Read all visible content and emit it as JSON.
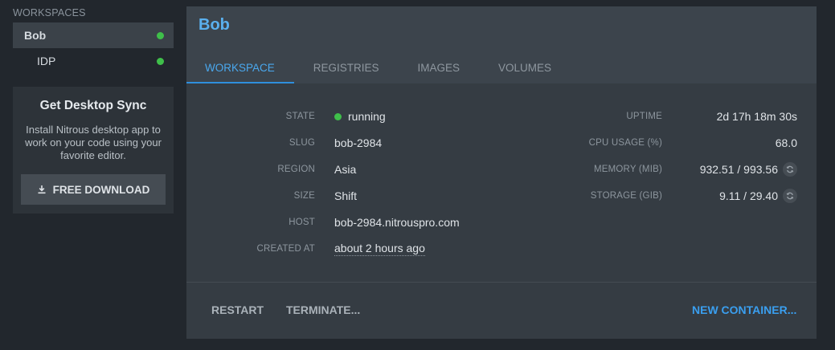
{
  "sidebar": {
    "heading": "WORKSPACES",
    "items": [
      {
        "label": "Bob",
        "status_color": "#3fbf4a",
        "active": true
      },
      {
        "label": "IDP",
        "status_color": "#3fbf4a",
        "active": false
      }
    ],
    "promo": {
      "title": "Get Desktop Sync",
      "text": "Install Nitrous desktop app to work on your code using your favorite editor.",
      "button_label": "FREE DOWNLOAD",
      "button_icon": "download-icon"
    }
  },
  "panel": {
    "title": "Bob",
    "tabs": [
      {
        "label": "WORKSPACE",
        "active": true
      },
      {
        "label": "REGISTRIES",
        "active": false
      },
      {
        "label": "IMAGES",
        "active": false
      },
      {
        "label": "VOLUMES",
        "active": false
      }
    ],
    "details_left": [
      {
        "label": "STATE",
        "value": "running"
      },
      {
        "label": "SLUG",
        "value": "bob-2984"
      },
      {
        "label": "REGION",
        "value": "Asia"
      },
      {
        "label": "SIZE",
        "value": "Shift"
      },
      {
        "label": "HOST",
        "value": "bob-2984.nitrouspro.com"
      },
      {
        "label": "CREATED AT",
        "value": "about 2 hours ago"
      }
    ],
    "details_right": [
      {
        "label": "UPTIME",
        "value": "2d 17h 18m 30s"
      },
      {
        "label": "CPU USAGE (%)",
        "value": "68.0"
      },
      {
        "label": "MEMORY (MiB)",
        "value": "932.51 / 993.56",
        "icon": "refresh-icon"
      },
      {
        "label": "STORAGE (GiB)",
        "value": "9.11 / 29.40",
        "icon": "refresh-icon"
      }
    ],
    "actions": {
      "restart": "RESTART",
      "terminate": "TERMINATE...",
      "new_container": "NEW CONTAINER..."
    }
  },
  "colors": {
    "accent": "#4aa8ee",
    "running": "#3fbf4a",
    "panel_bg": "#353c43",
    "page_bg": "#22272d"
  }
}
